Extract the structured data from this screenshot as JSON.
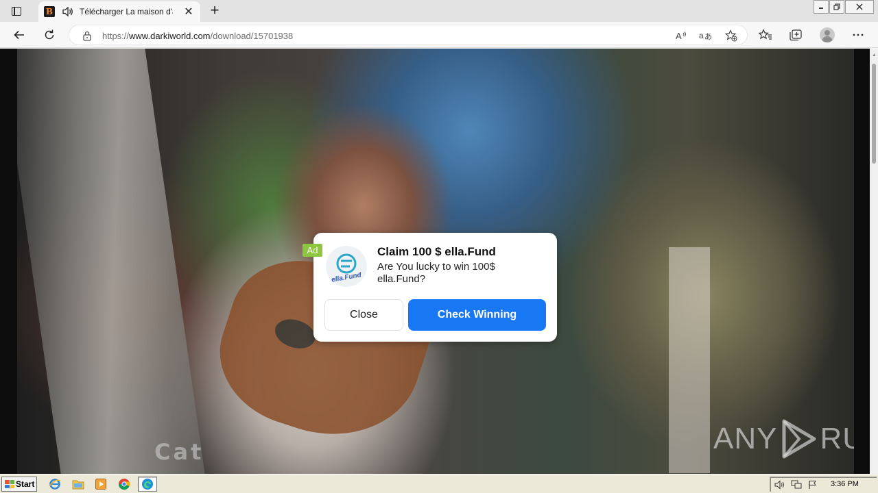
{
  "browser": {
    "tab": {
      "favicon_letter": "B",
      "title": "Télécharger La maison d'à"
    },
    "address": {
      "scheme": "https://",
      "host": "www.darkiworld.com",
      "path": "/download/15701938"
    },
    "icons": [
      "back-icon",
      "refresh-icon",
      "lock-icon",
      "read-aloud-icon",
      "translate-icon",
      "add-favorite-icon",
      "favorites-icon",
      "collections-icon",
      "profile-icon",
      "more-icon"
    ]
  },
  "page": {
    "video_caption_text": "Cat",
    "watermark": {
      "left": "ANY",
      "right": "RUN"
    }
  },
  "ad_popup": {
    "badge": "Ad",
    "logo_name": "ella.Fund",
    "title": "Claim 100 $ ella.Fund",
    "body": "Are You lucky to win 100$ ella.Fund?",
    "close_label": "Close",
    "cta_label": "Check Winning",
    "cta_color": "#1877f2"
  },
  "taskbar": {
    "start_label": "Start",
    "apps": [
      "internet-explorer",
      "file-explorer",
      "media-player",
      "chrome",
      "edge"
    ],
    "active_app": "edge",
    "clock": "3:36 PM"
  }
}
